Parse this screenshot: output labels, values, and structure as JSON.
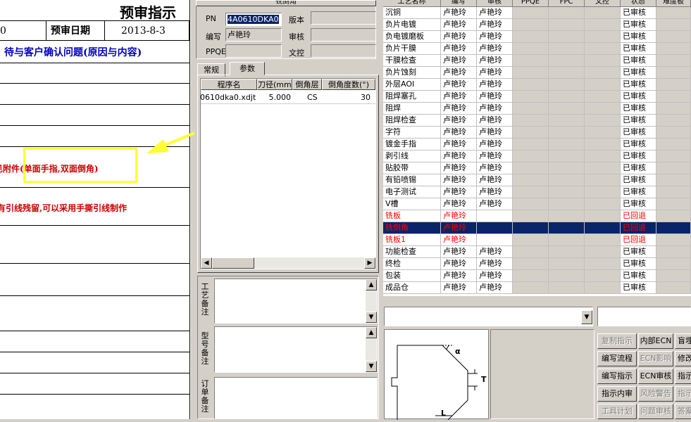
{
  "document": {
    "title": "预审指示",
    "left_cell": "0",
    "date_label": "预审日期",
    "date_value": "2013-8-3",
    "section_heading": "待与客户确认问题(原因与内容)",
    "note1": "见附件(单面手指,双面倒角)",
    "note2": "有引线残留,可以采用手撕引线制作"
  },
  "info": {
    "group_title": "铣倒角",
    "pn_label": "PN",
    "pn_value": "4A0610DKA0",
    "version_label": "版本",
    "version_value": "",
    "author_label": "编写",
    "author_value": "卢艳玲",
    "review_label": "审核",
    "review_value": "",
    "ppqe_label": "PPQE",
    "ppqe_value": "",
    "doccontrol_label": "文控",
    "doccontrol_value": ""
  },
  "tabs": [
    "常规",
    "参数"
  ],
  "param_table": {
    "headers": [
      "程序名",
      "刀径(mm)",
      "倒角层",
      "倒角度数(°)"
    ],
    "rows": [
      {
        "program": "0610dka0.xdjt",
        "diameter": "5.000",
        "layer": "CS",
        "degree": "30"
      }
    ]
  },
  "remarks": {
    "process_label": "工艺备注",
    "model_label": "型号备注",
    "order_label": "订单备注"
  },
  "process_grid": {
    "headers": [
      "工艺名称",
      "编写",
      "审核",
      "PPQE",
      "FPC",
      "文控",
      "状态",
      "难度板"
    ],
    "rows": [
      {
        "name": "沉铜",
        "author": "卢艳玲",
        "reviewer": "卢艳玲",
        "status": "已审核",
        "style": "normal"
      },
      {
        "name": "负片电镀",
        "author": "卢艳玲",
        "reviewer": "卢艳玲",
        "status": "已审核",
        "style": "normal"
      },
      {
        "name": "负电镀磨板",
        "author": "卢艳玲",
        "reviewer": "卢艳玲",
        "status": "已审核",
        "style": "normal"
      },
      {
        "name": "负片干膜",
        "author": "卢艳玲",
        "reviewer": "卢艳玲",
        "status": "已审核",
        "style": "normal"
      },
      {
        "name": "干膜检查",
        "author": "卢艳玲",
        "reviewer": "卢艳玲",
        "status": "已审核",
        "style": "normal"
      },
      {
        "name": "负片蚀刻",
        "author": "卢艳玲",
        "reviewer": "卢艳玲",
        "status": "已审核",
        "style": "normal"
      },
      {
        "name": "外层AOI",
        "author": "卢艳玲",
        "reviewer": "卢艳玲",
        "status": "已审核",
        "style": "normal"
      },
      {
        "name": "阻焊塞孔",
        "author": "卢艳玲",
        "reviewer": "卢艳玲",
        "status": "已审核",
        "style": "normal"
      },
      {
        "name": "阻焊",
        "author": "卢艳玲",
        "reviewer": "卢艳玲",
        "status": "已审核",
        "style": "normal"
      },
      {
        "name": "阻焊检查",
        "author": "卢艳玲",
        "reviewer": "卢艳玲",
        "status": "已审核",
        "style": "normal"
      },
      {
        "name": "字符",
        "author": "卢艳玲",
        "reviewer": "卢艳玲",
        "status": "已审核",
        "style": "normal"
      },
      {
        "name": "镀金手指",
        "author": "卢艳玲",
        "reviewer": "卢艳玲",
        "status": "已审核",
        "style": "normal"
      },
      {
        "name": "剥引线",
        "author": "卢艳玲",
        "reviewer": "卢艳玲",
        "status": "已审核",
        "style": "normal"
      },
      {
        "name": "贴胶带",
        "author": "卢艳玲",
        "reviewer": "卢艳玲",
        "status": "已审核",
        "style": "normal"
      },
      {
        "name": "有铅喷锡",
        "author": "卢艳玲",
        "reviewer": "卢艳玲",
        "status": "已审核",
        "style": "normal"
      },
      {
        "name": "电子测试",
        "author": "卢艳玲",
        "reviewer": "卢艳玲",
        "status": "已审核",
        "style": "normal"
      },
      {
        "name": "V槽",
        "author": "卢艳玲",
        "reviewer": "卢艳玲",
        "status": "已审核",
        "style": "normal"
      },
      {
        "name": "铣板",
        "author": "卢艳玲",
        "reviewer": "",
        "status": "已回退",
        "style": "returned"
      },
      {
        "name": "铣倒角",
        "author": "卢艳玲",
        "reviewer": "",
        "status": "已回退",
        "style": "selected"
      },
      {
        "name": "铣板1",
        "author": "卢艳玲",
        "reviewer": "",
        "status": "已回退",
        "style": "returned"
      },
      {
        "name": "功能检查",
        "author": "卢艳玲",
        "reviewer": "卢艳玲",
        "status": "已审核",
        "style": "normal"
      },
      {
        "name": "终检",
        "author": "卢艳玲",
        "reviewer": "卢艳玲",
        "status": "已审核",
        "style": "normal"
      },
      {
        "name": "包装",
        "author": "卢艳玲",
        "reviewer": "卢艳玲",
        "status": "已审核",
        "style": "normal"
      },
      {
        "name": "成品仓",
        "author": "卢艳玲",
        "reviewer": "卢艳玲",
        "status": "已审核",
        "style": "normal"
      }
    ]
  },
  "diagram": {
    "alpha_label": "α",
    "t_label": "T",
    "l_label": "L"
  },
  "commands": [
    {
      "label": "复制指示",
      "enabled": false
    },
    {
      "label": "内部ECN",
      "enabled": true
    },
    {
      "label": "盲埋",
      "enabled": true
    },
    {
      "label": "编写流程",
      "enabled": true
    },
    {
      "label": "ECN影响",
      "enabled": false
    },
    {
      "label": "修改",
      "enabled": true
    },
    {
      "label": "编写指示",
      "enabled": true
    },
    {
      "label": "ECN审核",
      "enabled": true
    },
    {
      "label": "指示",
      "enabled": true
    },
    {
      "label": "指示内审",
      "enabled": true
    },
    {
      "label": "风险警告",
      "enabled": false
    },
    {
      "label": "指示",
      "enabled": false
    },
    {
      "label": "工具计划",
      "enabled": false
    },
    {
      "label": "问题审核",
      "enabled": false
    },
    {
      "label": "答案",
      "enabled": false
    }
  ],
  "colors": {
    "selected_bg": "#0a246a",
    "returned_text": "#ff0000",
    "arrow": "#ffff33",
    "heading_blue": "#0000c0",
    "note_red": "#cc0000"
  }
}
